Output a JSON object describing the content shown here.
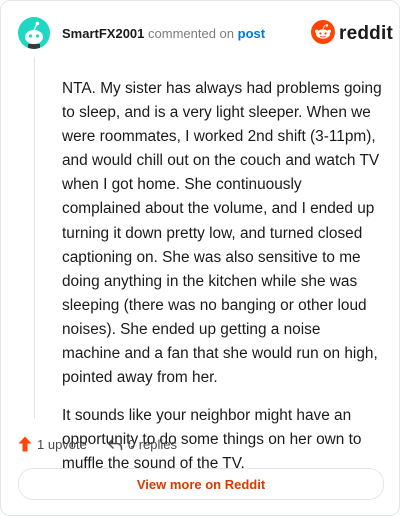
{
  "comment": {
    "username": "SmartFX2001",
    "action_text": "commented on",
    "post_link": "post",
    "paragraphs": [
      "NTA. My sister has always had problems going to sleep, and is a very light sleeper. When we were roommates, I worked 2nd shift (3-11pm), and would chill out on the couch and watch TV when I got home. She continuously complained about the volume, and I ended up turning it down pretty low, and turned closed captioning on. She was also sensitive to me doing anything in the kitchen while she was sleeping (there was no banging or other loud noises). She ended up getting a noise machine and a fan that she would run on high, pointed away from her.",
      "It sounds like your neighbor might have an opportunity to do some things on her own to muffle the sound of the TV."
    ],
    "upvotes": "1 upvote",
    "replies": "0 replies"
  },
  "brand": {
    "wordmark": "reddit",
    "icon": "reddit-snoo-icon",
    "color": "#ff4500"
  },
  "footer": {
    "view_more": "View more on Reddit",
    "link_color": "#d93a00"
  },
  "avatar_color": "#1ed7c4"
}
